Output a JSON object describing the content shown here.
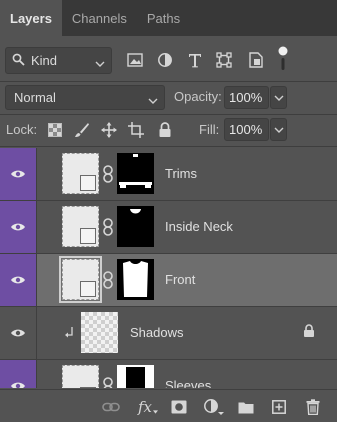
{
  "tabs": [
    {
      "label": "Layers",
      "active": true
    },
    {
      "label": "Channels",
      "active": false
    },
    {
      "label": "Paths",
      "active": false
    }
  ],
  "filter": {
    "kind_label": "Kind",
    "icons": [
      "image-filter-icon",
      "adjustment-filter-icon",
      "type-filter-icon",
      "shape-filter-icon",
      "smart-object-filter-icon",
      "filter-toggle-icon"
    ]
  },
  "blend": {
    "mode": "Normal",
    "opacity_label": "Opacity:",
    "opacity_value": "100%",
    "fill_label": "Fill:",
    "fill_value": "100%"
  },
  "lock": {
    "label": "Lock:",
    "icons": [
      "lock-transparent-pixels-icon",
      "lock-image-pixels-icon",
      "lock-position-icon",
      "lock-artboard-icon",
      "lock-all-icon"
    ]
  },
  "layers": [
    {
      "name": "Trims",
      "visible": true,
      "purple": true,
      "selected": false,
      "mask": "trims"
    },
    {
      "name": "Inside Neck",
      "visible": true,
      "purple": true,
      "selected": false,
      "mask": "neck"
    },
    {
      "name": "Front",
      "visible": true,
      "purple": true,
      "selected": true,
      "mask": "front"
    },
    {
      "name": "Shadows",
      "visible": true,
      "purple": false,
      "selected": false,
      "clipped": true,
      "locked": true
    },
    {
      "name": "Sleeves",
      "visible": true,
      "purple": true,
      "selected": false,
      "mask": "sleeves"
    }
  ],
  "colors": {
    "panel_bg": "#535353",
    "tab_bar_bg": "#383838",
    "visibility_highlight": "#6e4ea3",
    "selected_row": "#6e6e6e"
  }
}
